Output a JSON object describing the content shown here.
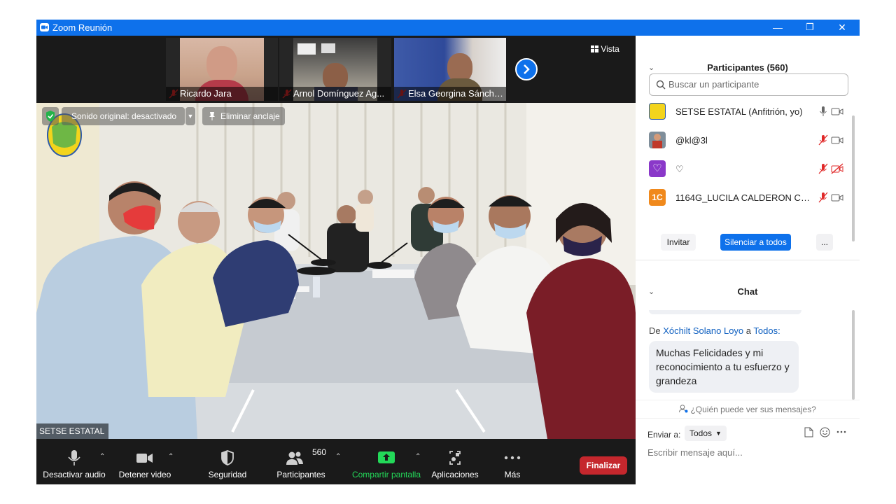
{
  "window": {
    "title": "Zoom Reunión",
    "minimize": "—",
    "restore": "❐",
    "close": "✕"
  },
  "gallery": {
    "thumbnails": [
      {
        "name": "Ricardo Jara"
      },
      {
        "name": "Arnol Domínguez Ag..."
      },
      {
        "name": "Elsa Georgina Sánche..."
      }
    ],
    "view_label": "Vista"
  },
  "main_video": {
    "sound_label": "Sonido original: desactivado",
    "unpin_label": "Eliminar anclaje",
    "speaker_name": "SETSE ESTATAL"
  },
  "toolbar": {
    "items": [
      {
        "label": "Desactivar audio",
        "icon": "microphone-icon"
      },
      {
        "label": "Detener video",
        "icon": "video-camera-icon"
      },
      {
        "label": "Seguridad",
        "icon": "shield-icon"
      },
      {
        "label": "Participantes",
        "icon": "participants-icon",
        "count": "560"
      },
      {
        "label": "Compartir pantalla",
        "icon": "share-screen-icon"
      },
      {
        "label": "Aplicaciones",
        "icon": "apps-icon"
      },
      {
        "label": "Más",
        "icon": "more-icon"
      }
    ],
    "end_label": "Finalizar"
  },
  "participants": {
    "title": "Participantes (560)",
    "search_placeholder": "Buscar un participante",
    "list": [
      {
        "name": "SETSE ESTATAL (Anfitrión, yo)",
        "avatar_text": "",
        "mic": "on",
        "cam": "on"
      },
      {
        "name": "@kl@3l",
        "avatar_text": "",
        "mic": "muted",
        "cam": "on"
      },
      {
        "name": "♡",
        "avatar_text": "",
        "mic": "muted",
        "cam": "off"
      },
      {
        "name": "1164G_LUCILA CALDERON CAR...",
        "avatar_text": "1C",
        "mic": "muted",
        "cam": "on"
      }
    ],
    "invite_label": "Invitar",
    "mute_all_label": "Silenciar a todos",
    "more_label": "..."
  },
  "chat": {
    "title": "Chat",
    "from_prefix": "De",
    "from_name": "Xóchilt Solano Loyo",
    "to_word": "a",
    "to_name": "Todos:",
    "message": "Muchas Felicidades y mi reconocimiento a tu esfuerzo y grandeza",
    "who_can_see": "¿Quién puede ver sus mensajes?",
    "send_to_label": "Enviar a:",
    "send_to_value": "Todos",
    "input_placeholder": "Escribir mensaje aquí..."
  },
  "colors": {
    "zoom_blue": "#0e71eb",
    "end_red": "#c5272d",
    "share_green": "#23d959",
    "muted_red": "#e02828"
  }
}
